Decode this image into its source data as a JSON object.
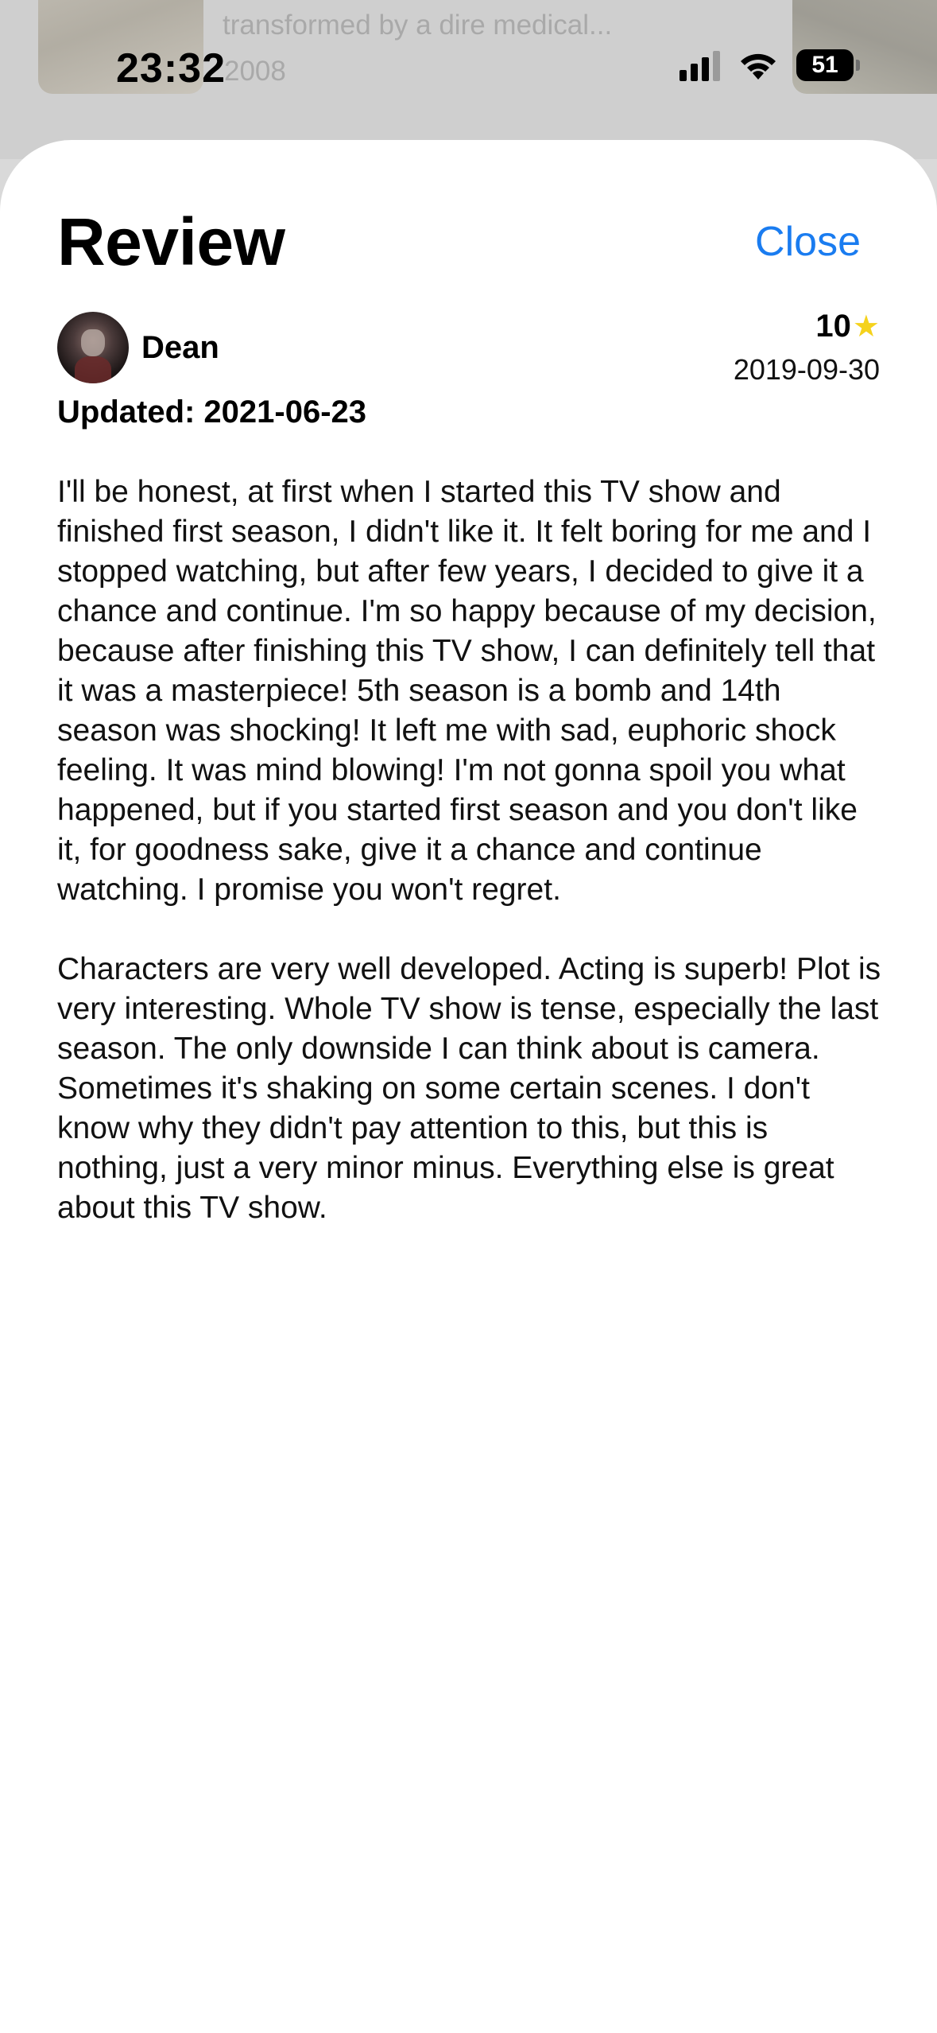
{
  "background": {
    "overview_snippet": "transformed by a dire medical...",
    "year_snippet": "2008"
  },
  "status_bar": {
    "time": "23:32",
    "battery": "51",
    "icons": [
      "cellular-signal-icon",
      "wifi-icon",
      "battery-icon"
    ]
  },
  "sheet": {
    "title": "Review",
    "close_label": "Close",
    "accent_color": "#1a7cf0"
  },
  "review": {
    "author": "Dean",
    "rating": "10",
    "star_color": "#f5d21c",
    "date": "2019-09-30",
    "updated_label": "Updated: 2021-06-23",
    "paragraphs": [
      "I'll be honest, at first when I started this TV show and finished first season, I didn't like it. It felt boring for me and I stopped watching, but after few years, I decided to give it a chance and continue. I'm so happy because of my decision, because after finishing this TV show, I can definitely tell that it was a masterpiece! 5th season is a bomb and 14th season was shocking! It left me with sad, euphoric shock feeling. It was mind blowing! I'm not gonna spoil you what happened, but if you started first season and you don't like it, for goodness sake, give it a chance and continue watching. I promise you won't regret.",
      "Characters are very well developed. Acting is superb! Plot is very interesting. Whole TV show is tense, especially the last season. The only downside I can think about is camera. Sometimes it's shaking on some certain scenes. I don't know why they didn't pay attention to this, but this is nothing, just a very minor minus. Everything else is great about this TV show."
    ]
  }
}
